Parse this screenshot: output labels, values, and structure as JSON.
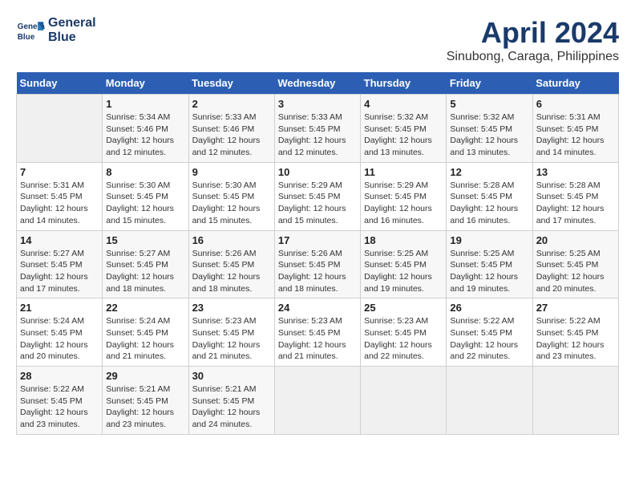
{
  "header": {
    "logo_line1": "General",
    "logo_line2": "Blue",
    "month_year": "April 2024",
    "location": "Sinubong, Caraga, Philippines"
  },
  "days_of_week": [
    "Sunday",
    "Monday",
    "Tuesday",
    "Wednesday",
    "Thursday",
    "Friday",
    "Saturday"
  ],
  "weeks": [
    [
      {
        "day": "",
        "info": ""
      },
      {
        "day": "1",
        "info": "Sunrise: 5:34 AM\nSunset: 5:46 PM\nDaylight: 12 hours\nand 12 minutes."
      },
      {
        "day": "2",
        "info": "Sunrise: 5:33 AM\nSunset: 5:46 PM\nDaylight: 12 hours\nand 12 minutes."
      },
      {
        "day": "3",
        "info": "Sunrise: 5:33 AM\nSunset: 5:45 PM\nDaylight: 12 hours\nand 12 minutes."
      },
      {
        "day": "4",
        "info": "Sunrise: 5:32 AM\nSunset: 5:45 PM\nDaylight: 12 hours\nand 13 minutes."
      },
      {
        "day": "5",
        "info": "Sunrise: 5:32 AM\nSunset: 5:45 PM\nDaylight: 12 hours\nand 13 minutes."
      },
      {
        "day": "6",
        "info": "Sunrise: 5:31 AM\nSunset: 5:45 PM\nDaylight: 12 hours\nand 14 minutes."
      }
    ],
    [
      {
        "day": "7",
        "info": "Sunrise: 5:31 AM\nSunset: 5:45 PM\nDaylight: 12 hours\nand 14 minutes."
      },
      {
        "day": "8",
        "info": "Sunrise: 5:30 AM\nSunset: 5:45 PM\nDaylight: 12 hours\nand 15 minutes."
      },
      {
        "day": "9",
        "info": "Sunrise: 5:30 AM\nSunset: 5:45 PM\nDaylight: 12 hours\nand 15 minutes."
      },
      {
        "day": "10",
        "info": "Sunrise: 5:29 AM\nSunset: 5:45 PM\nDaylight: 12 hours\nand 15 minutes."
      },
      {
        "day": "11",
        "info": "Sunrise: 5:29 AM\nSunset: 5:45 PM\nDaylight: 12 hours\nand 16 minutes."
      },
      {
        "day": "12",
        "info": "Sunrise: 5:28 AM\nSunset: 5:45 PM\nDaylight: 12 hours\nand 16 minutes."
      },
      {
        "day": "13",
        "info": "Sunrise: 5:28 AM\nSunset: 5:45 PM\nDaylight: 12 hours\nand 17 minutes."
      }
    ],
    [
      {
        "day": "14",
        "info": "Sunrise: 5:27 AM\nSunset: 5:45 PM\nDaylight: 12 hours\nand 17 minutes."
      },
      {
        "day": "15",
        "info": "Sunrise: 5:27 AM\nSunset: 5:45 PM\nDaylight: 12 hours\nand 18 minutes."
      },
      {
        "day": "16",
        "info": "Sunrise: 5:26 AM\nSunset: 5:45 PM\nDaylight: 12 hours\nand 18 minutes."
      },
      {
        "day": "17",
        "info": "Sunrise: 5:26 AM\nSunset: 5:45 PM\nDaylight: 12 hours\nand 18 minutes."
      },
      {
        "day": "18",
        "info": "Sunrise: 5:25 AM\nSunset: 5:45 PM\nDaylight: 12 hours\nand 19 minutes."
      },
      {
        "day": "19",
        "info": "Sunrise: 5:25 AM\nSunset: 5:45 PM\nDaylight: 12 hours\nand 19 minutes."
      },
      {
        "day": "20",
        "info": "Sunrise: 5:25 AM\nSunset: 5:45 PM\nDaylight: 12 hours\nand 20 minutes."
      }
    ],
    [
      {
        "day": "21",
        "info": "Sunrise: 5:24 AM\nSunset: 5:45 PM\nDaylight: 12 hours\nand 20 minutes."
      },
      {
        "day": "22",
        "info": "Sunrise: 5:24 AM\nSunset: 5:45 PM\nDaylight: 12 hours\nand 21 minutes."
      },
      {
        "day": "23",
        "info": "Sunrise: 5:23 AM\nSunset: 5:45 PM\nDaylight: 12 hours\nand 21 minutes."
      },
      {
        "day": "24",
        "info": "Sunrise: 5:23 AM\nSunset: 5:45 PM\nDaylight: 12 hours\nand 21 minutes."
      },
      {
        "day": "25",
        "info": "Sunrise: 5:23 AM\nSunset: 5:45 PM\nDaylight: 12 hours\nand 22 minutes."
      },
      {
        "day": "26",
        "info": "Sunrise: 5:22 AM\nSunset: 5:45 PM\nDaylight: 12 hours\nand 22 minutes."
      },
      {
        "day": "27",
        "info": "Sunrise: 5:22 AM\nSunset: 5:45 PM\nDaylight: 12 hours\nand 23 minutes."
      }
    ],
    [
      {
        "day": "28",
        "info": "Sunrise: 5:22 AM\nSunset: 5:45 PM\nDaylight: 12 hours\nand 23 minutes."
      },
      {
        "day": "29",
        "info": "Sunrise: 5:21 AM\nSunset: 5:45 PM\nDaylight: 12 hours\nand 23 minutes."
      },
      {
        "day": "30",
        "info": "Sunrise: 5:21 AM\nSunset: 5:45 PM\nDaylight: 12 hours\nand 24 minutes."
      },
      {
        "day": "",
        "info": ""
      },
      {
        "day": "",
        "info": ""
      },
      {
        "day": "",
        "info": ""
      },
      {
        "day": "",
        "info": ""
      }
    ]
  ]
}
